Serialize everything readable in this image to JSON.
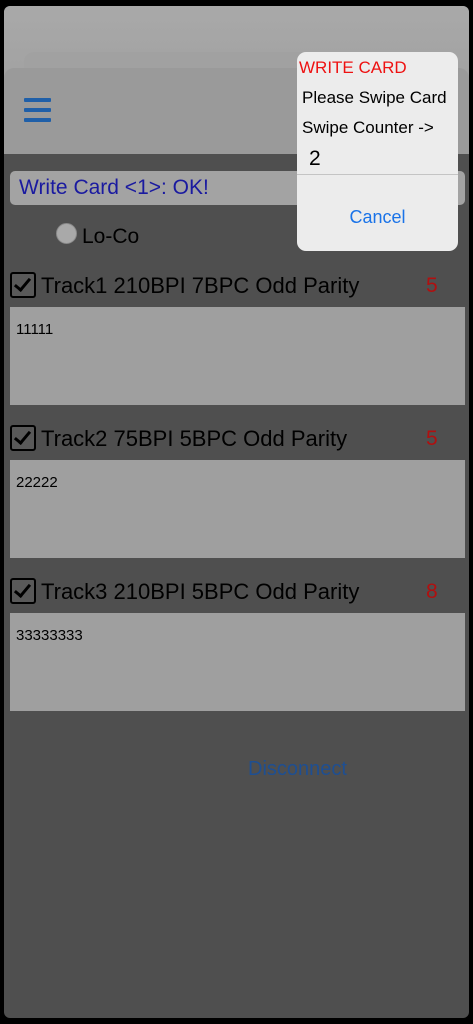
{
  "status": {
    "message": "Write Card <1>: OK!"
  },
  "mode": {
    "option_label": "Lo-Co"
  },
  "tracks": [
    {
      "label": "Track1  210BPI 7BPC Odd Parity",
      "count": "5",
      "value": "11111"
    },
    {
      "label": "Track2  75BPI 5BPC Odd Parity",
      "count": "5",
      "value": "22222"
    },
    {
      "label": "Track3  210BPI 5BPC Odd Parity",
      "count": "8",
      "value": "33333333"
    }
  ],
  "actions": {
    "disconnect_label": "Disconnect"
  },
  "dialog": {
    "title": "WRITE CARD",
    "message": "Please Swipe Card",
    "counter_label": "Swipe Counter ->",
    "counter_value": "2",
    "cancel_label": "Cancel"
  },
  "colors": {
    "accent": "#1a73e8",
    "status_text": "#1a1aa0",
    "count_text": "#b01010",
    "dialog_title": "#ee1111"
  },
  "icons": {
    "menu": "hamburger-menu-icon",
    "checkbox": "checkbox-checked-icon"
  }
}
